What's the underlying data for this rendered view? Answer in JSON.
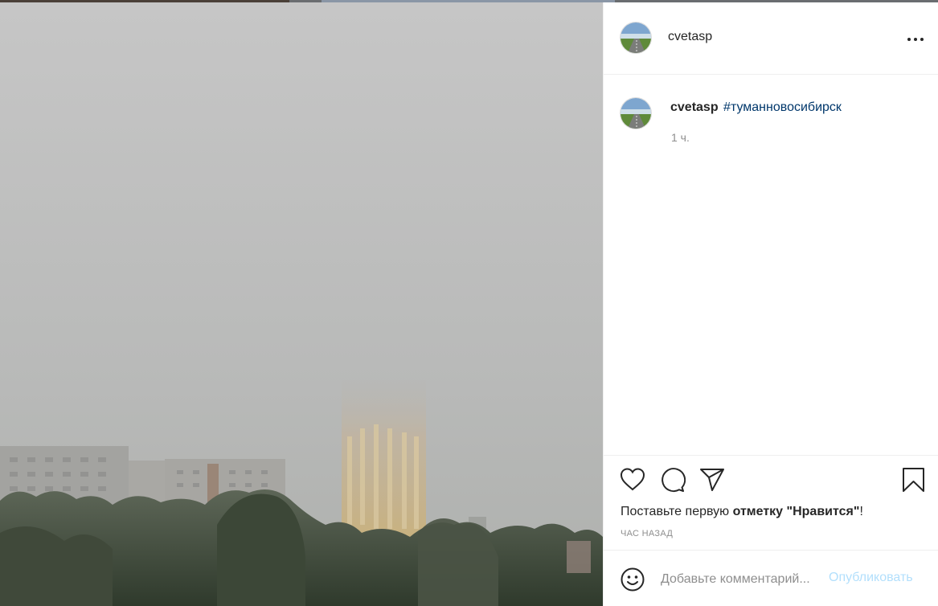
{
  "post": {
    "image_alt": "",
    "header": {
      "username": "cvetasp",
      "avatar_icon": "avatar-road-image",
      "more_icon": "more-options-icon"
    },
    "caption": {
      "username": "cvetasp",
      "hashtag": "#туманновосибирск",
      "age": "1 ч."
    },
    "actions": {
      "like_icon": "heart-icon",
      "comment_icon": "comment-bubble-icon",
      "share_icon": "paper-plane-icon",
      "save_icon": "bookmark-icon",
      "likes_text_before": "Поставьте первую ",
      "likes_text_bold": "отметку \"Нравится\"",
      "likes_text_after": "!",
      "time_ago": "час назад"
    },
    "comment": {
      "placeholder": "Добавьте комментарий...",
      "publish_label": "Опубликовать",
      "emoji_icon": "smiley-icon"
    }
  },
  "colors": {
    "hashtag": "#00376b",
    "publish_disabled": "#b2dffc",
    "muted": "#8e8e8e",
    "text": "#262626"
  }
}
